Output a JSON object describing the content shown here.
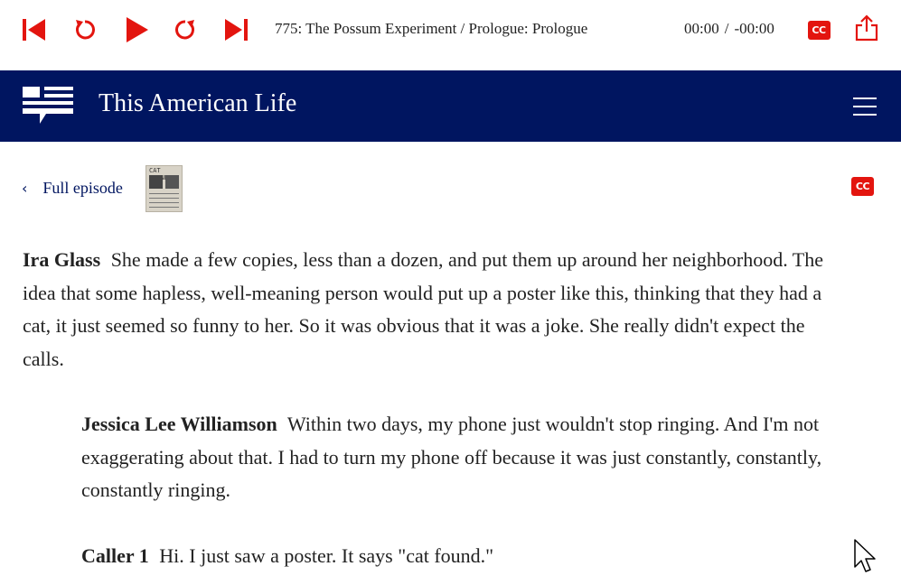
{
  "player": {
    "episode_title": "775: The Possum Experiment / Prologue: Prologue",
    "time_current": "00:00",
    "time_separator": "/",
    "time_remaining": "-00:00",
    "cc_label": "CC"
  },
  "header": {
    "brand": "This American Life"
  },
  "subnav": {
    "back_label": "Full episode",
    "thumbnail_text": "CAT FOUND!",
    "cc_label": "CC"
  },
  "transcript": [
    {
      "speaker": "Ira Glass",
      "text": "She made a few copies, less than a dozen, and put them up around her neighborhood. The idea that some hapless, well-meaning person would put up a poster like this, thinking that they had a cat, it just seemed so funny to her. So it was obvious that it was a joke. She really didn't expect the calls."
    },
    {
      "speaker": "Jessica Lee Williamson",
      "text": "Within two days, my phone just wouldn't stop ringing. And I'm not exaggerating about that. I had to turn my phone off because it was just constantly, constantly, constantly ringing."
    },
    {
      "speaker": "Caller 1",
      "text": "Hi. I just saw a poster. It says \"cat found.\""
    }
  ],
  "colors": {
    "accent_red": "#e3150f",
    "header_navy": "#001560"
  },
  "icons": [
    "skip-back-icon",
    "rewind-icon",
    "play-icon",
    "forward-icon",
    "skip-forward-icon",
    "closed-captions-icon",
    "share-icon",
    "logo-icon",
    "hamburger-menu-icon",
    "chevron-left-icon",
    "mouse-cursor-icon"
  ]
}
